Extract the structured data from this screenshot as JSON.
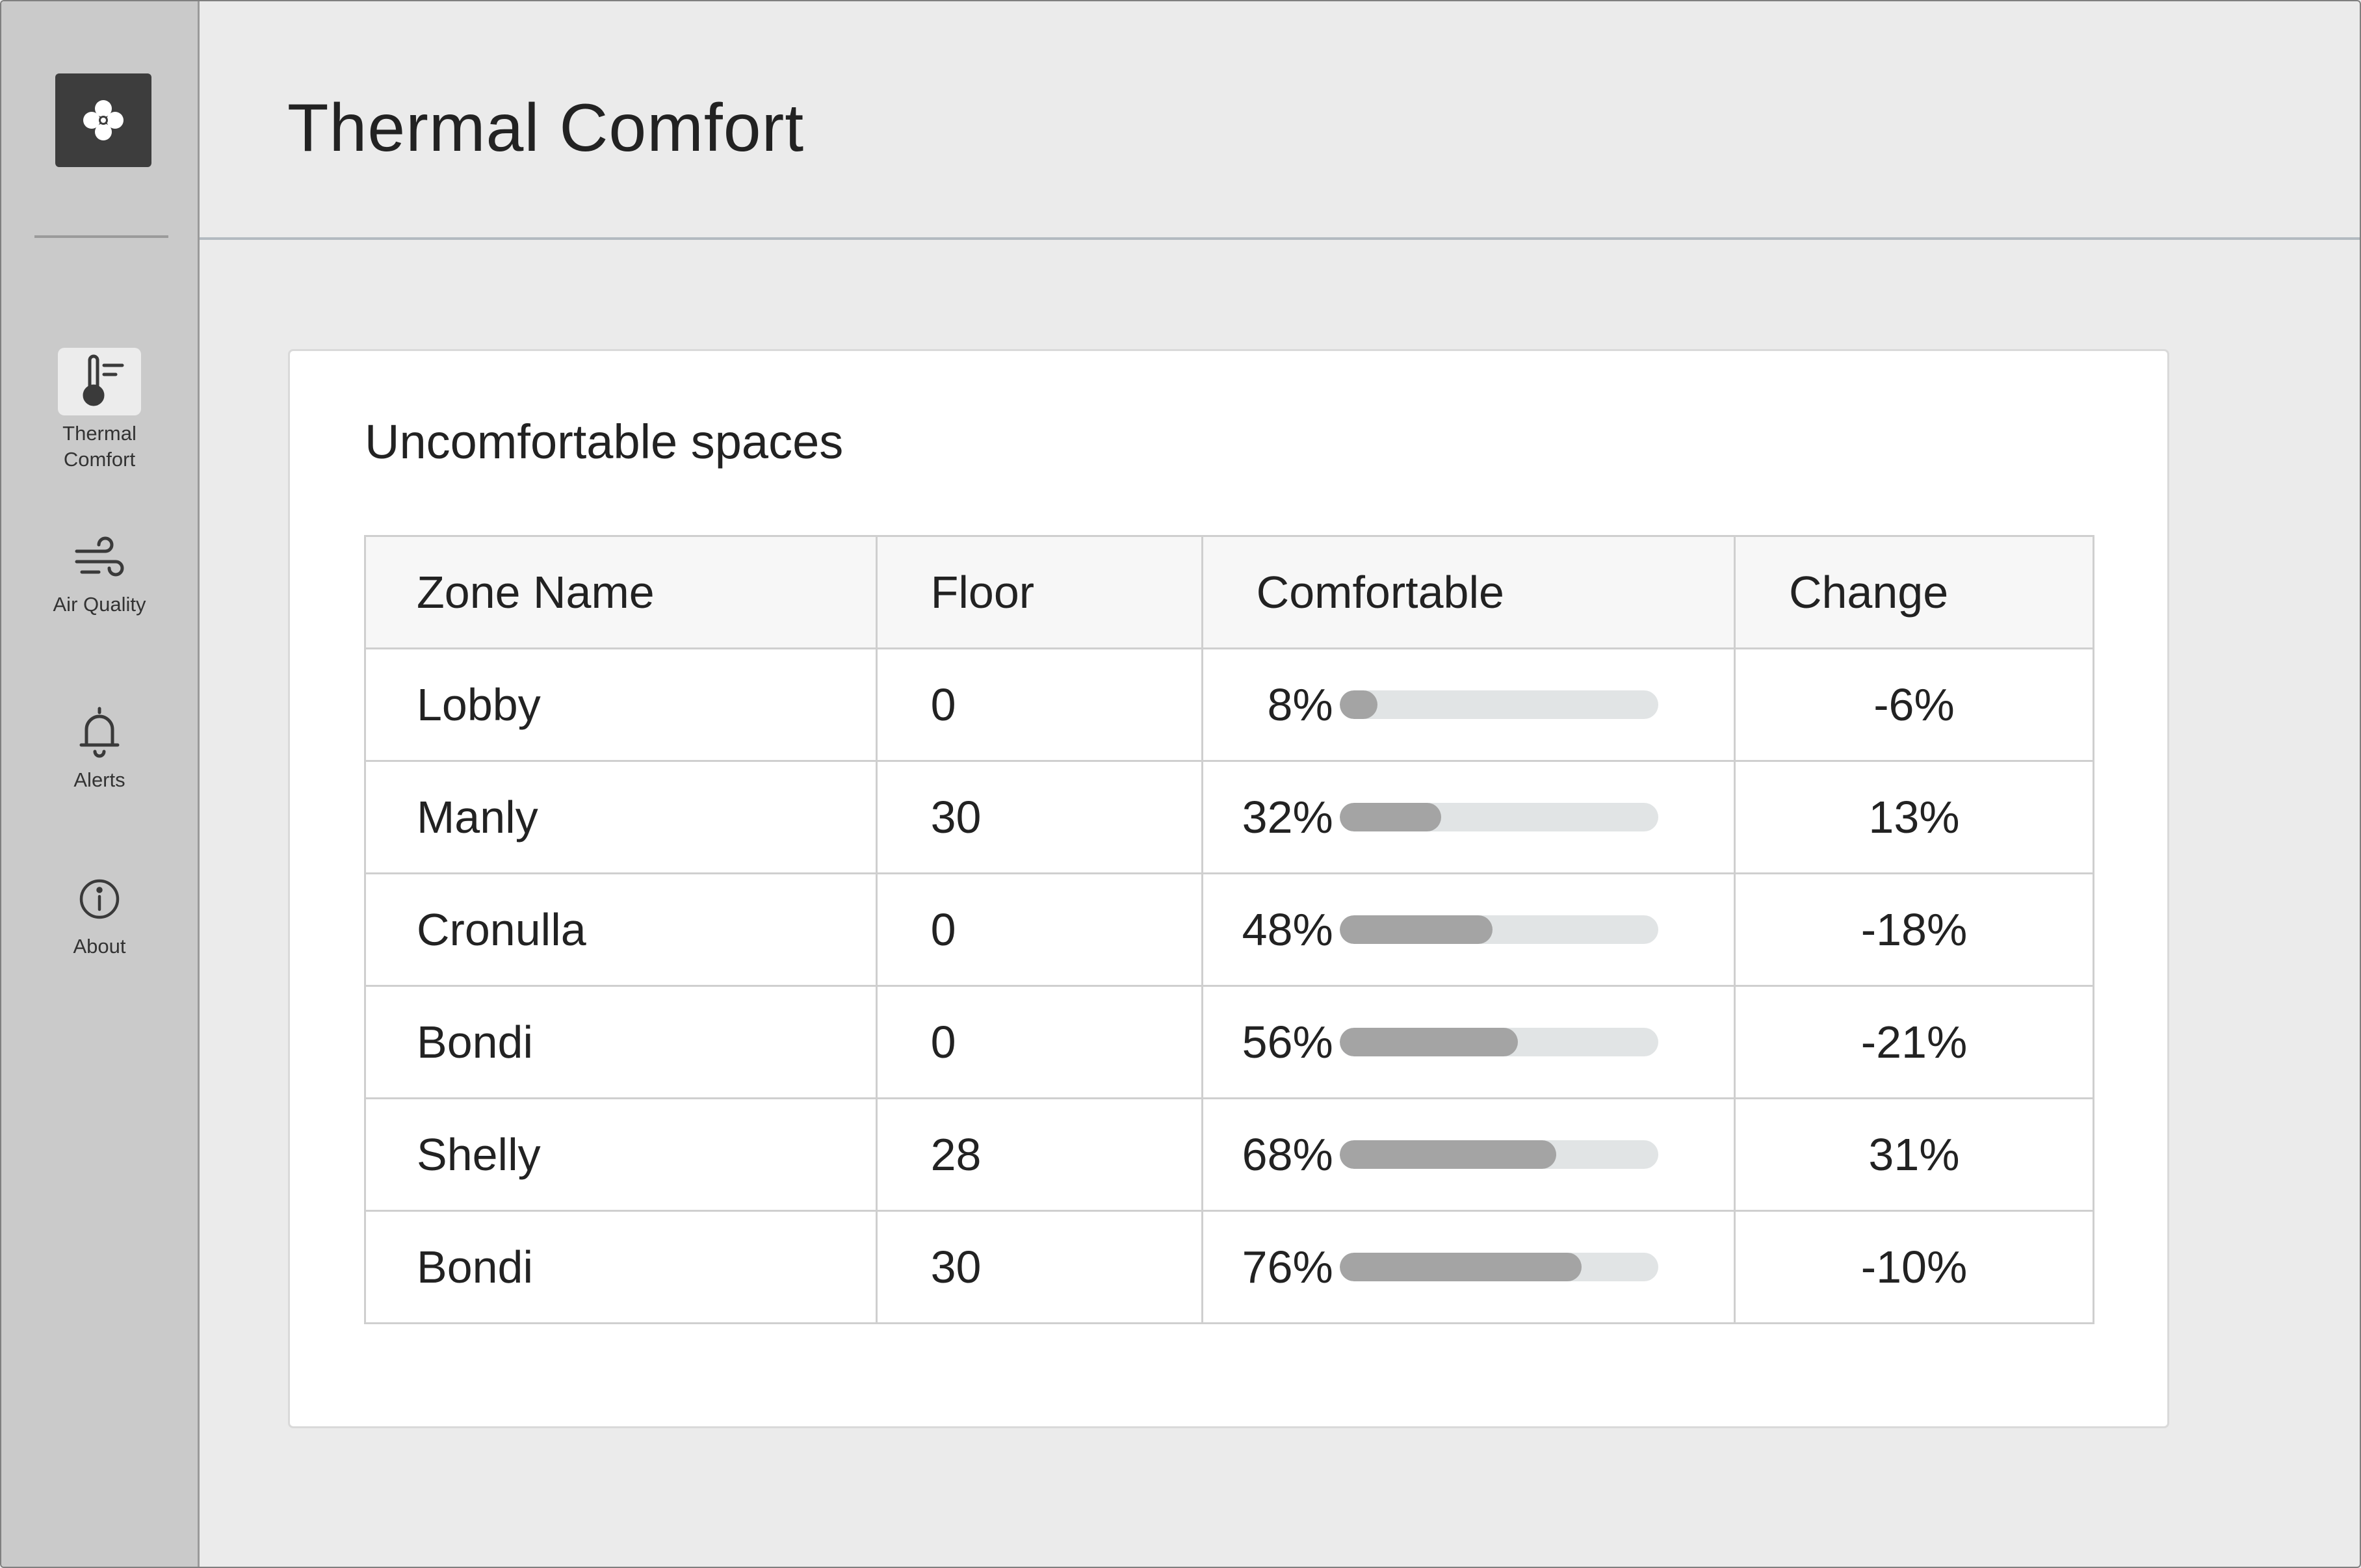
{
  "header": {
    "title": "Thermal Comfort"
  },
  "sidebar": {
    "logo_icon": "fan-icon",
    "items": [
      {
        "label": "Thermal\nComfort",
        "icon": "thermometer-icon",
        "active": true
      },
      {
        "label": "Air Quality",
        "icon": "wind-icon",
        "active": false
      },
      {
        "label": "Alerts",
        "icon": "bell-icon",
        "active": false
      },
      {
        "label": "About",
        "icon": "info-icon",
        "active": false
      }
    ]
  },
  "card": {
    "title": "Uncomfortable spaces",
    "table": {
      "columns": [
        "Zone Name",
        "Floor",
        "Comfortable",
        "Change"
      ],
      "rows": [
        {
          "zone": "Lobby",
          "floor": "0",
          "comfortable": "8%",
          "comfortable_value": 0.08,
          "change": "-6%"
        },
        {
          "zone": "Manly",
          "floor": "30",
          "comfortable": "32%",
          "comfortable_value": 0.32,
          "change": "13%"
        },
        {
          "zone": "Cronulla",
          "floor": "0",
          "comfortable": "48%",
          "comfortable_value": 0.48,
          "change": "-18%"
        },
        {
          "zone": "Bondi",
          "floor": "0",
          "comfortable": "56%",
          "comfortable_value": 0.56,
          "change": "-21%"
        },
        {
          "zone": "Shelly",
          "floor": "28",
          "comfortable": "68%",
          "comfortable_value": 0.68,
          "change": "31%"
        },
        {
          "zone": "Bondi",
          "floor": "30",
          "comfortable": "76%",
          "comfortable_value": 0.76,
          "change": "-10%"
        }
      ]
    }
  },
  "colors": {
    "sidebar_bg": "#cacaca",
    "page_bg": "#ebebeb",
    "logo_bg": "#3d3d3d",
    "bar_fill": "#a4a4a4",
    "bar_track": "#e1e4e5"
  }
}
